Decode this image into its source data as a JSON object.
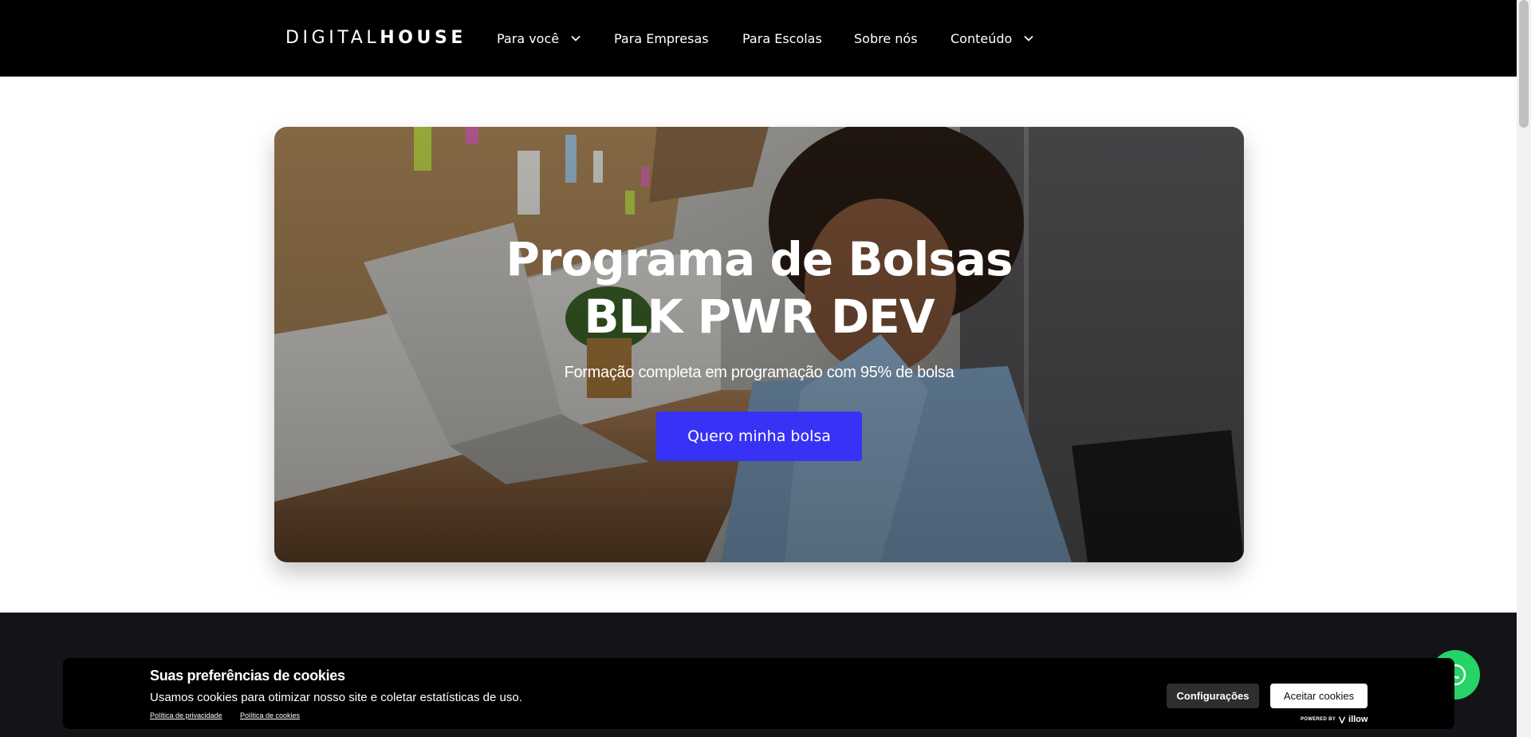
{
  "nav": {
    "logo_light": "DIGITAL",
    "logo_bold": "HOUSE",
    "items": [
      {
        "label": "Para você",
        "has_dropdown": true
      },
      {
        "label": "Para Empresas",
        "has_dropdown": false
      },
      {
        "label": "Para Escolas",
        "has_dropdown": false
      },
      {
        "label": "Sobre nós",
        "has_dropdown": false
      },
      {
        "label": "Conteúdo",
        "has_dropdown": true
      }
    ]
  },
  "hero": {
    "title_line1": "Programa de Bolsas",
    "title_line2": "BLK PWR DEV",
    "subtitle": "Formação completa em programação com 95% de bolsa",
    "cta_label": "Quero minha bolsa"
  },
  "cookie_banner": {
    "title": "Suas preferências de cookies",
    "text": "Usamos cookies para otimizar nosso site e coletar estatísticas de uso.",
    "privacy_link": "Política de privacidade",
    "cookies_link": "Política de cookies",
    "settings_label": "Configurações",
    "accept_label": "Aceitar cookies",
    "powered_by": "POWERED BY",
    "powered_brand": "illow"
  },
  "icons": {
    "dropdown": "chevron-down-icon",
    "whatsapp": "whatsapp-icon"
  },
  "colors": {
    "nav_bg": "#000000",
    "cta": "#3732f5",
    "band": "#141418",
    "whatsapp": "#25d366"
  }
}
